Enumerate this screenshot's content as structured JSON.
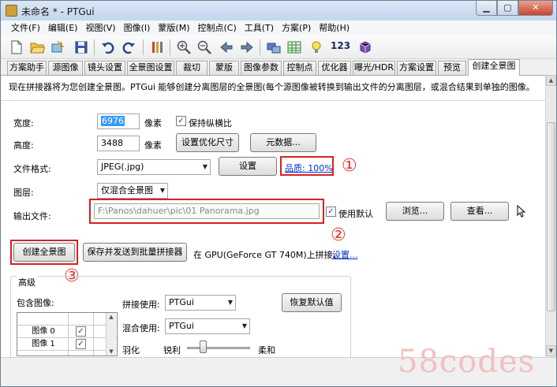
{
  "window": {
    "title": "未命名 * - PTGui",
    "min_label": "▁",
    "max_label": "▢",
    "close_label": "✕"
  },
  "menu": [
    "文件(F)",
    "编辑(E)",
    "视图(V)",
    "图像(I)",
    "蒙版(M)",
    "控制点(C)",
    "工具(T)",
    "方案(P)",
    "帮助(H)"
  ],
  "toolbar": {
    "icons": [
      "new-file-icon",
      "open-folder-icon",
      "image-wand-icon",
      "save-icon",
      "undo-icon",
      "redo-icon",
      "tools-icon",
      "zoom-in-icon",
      "zoom-out-icon",
      "arrow-left-icon",
      "arrow-right-icon",
      "panorama-editor-icon",
      "table-icon",
      "lightbulb-icon",
      "numbers-label",
      "plugin-icon"
    ],
    "number_label": "123"
  },
  "tabs": [
    "方案助手",
    "源图像",
    "镜头设置",
    "全景图设置",
    "裁切",
    "蒙版",
    "图像参数",
    "控制点",
    "优化器",
    "曝光/HDR",
    "方案设置",
    "预览",
    "创建全景图"
  ],
  "info_text": "现在拼接器将为您创建全景图。PTGui 能够创建分离图层的全景图(每个源图像被转换到输出文件的分离图层，或混合结果到单独的图像。",
  "form": {
    "width_label": "宽度:",
    "width_value": "6976",
    "width_unit": "像素",
    "keep_ratio_label": "保持纵横比",
    "height_label": "高度:",
    "height_value": "3488",
    "height_unit": "像素",
    "set_optimal_size_button": "设置优化尺寸",
    "metadata_button": "元数据...",
    "file_format_label": "文件格式:",
    "file_format_value": "JPEG(.jpg)",
    "settings_button": "设置",
    "quality_link": "品质: 100%",
    "layer_label": "图层:",
    "layer_value": "仅混合全景图",
    "output_file_label": "输出文件:",
    "output_file_value": "F:\\Panos\\dahuer\\pic\\01 Panorama.jpg",
    "use_default_label": "使用默认",
    "browse_button": "浏览...",
    "view_button": "查看...",
    "create_button": "创建全景图",
    "save_batch_button": "保存并发送到批量拼接器",
    "gpu_text": "在 GPU(GeForce GT 740M)上拼接。",
    "gpu_settings_link": "设置..."
  },
  "annotations": {
    "circle_1": "①",
    "circle_2": "②",
    "circle_3": "③"
  },
  "advanced": {
    "title": "高级",
    "include_images_label": "包含图像:",
    "image_rows": [
      "图像 0",
      "图像 1"
    ],
    "stitcher_label": "拼接使用:",
    "stitcher_value": "PTGui",
    "blender_label": "混合使用:",
    "blender_value": "PTGui",
    "restore_defaults_button": "恢复默认值",
    "feather_label": "羽化",
    "sharp_label": "锐利",
    "soft_label": "柔和"
  },
  "feather_slider": 0.25,
  "watermark": "58codes",
  "colors": {
    "annotation_red": "#d92121",
    "link_blue": "#0033cc",
    "watermark_pink": "#f2c0c0"
  }
}
